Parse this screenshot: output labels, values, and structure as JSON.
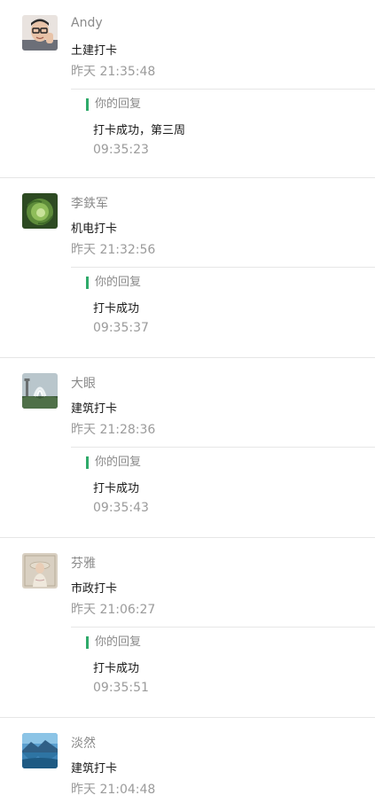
{
  "checkins": [
    {
      "name": "Andy",
      "message": "土建打卡",
      "time": "昨天 21:35:48",
      "avatar": "avatar-man-glasses",
      "reply": {
        "label": "你的回复",
        "text": "打卡成功，第三周",
        "time": "09:35:23"
      }
    },
    {
      "name": "李鉄军",
      "message": "机电打卡",
      "time": "昨天 21:32:56",
      "avatar": "avatar-cabbage",
      "reply": {
        "label": "你的回复",
        "text": "打卡成功",
        "time": "09:35:37"
      }
    },
    {
      "name": "大眼",
      "message": "建筑打卡",
      "time": "昨天 21:28:36",
      "avatar": "avatar-fountain",
      "reply": {
        "label": "你的回复",
        "text": "打卡成功",
        "time": "09:35:43"
      }
    },
    {
      "name": "芬雅",
      "message": "市政打卡",
      "time": "昨天 21:06:27",
      "avatar": "avatar-woman-portrait",
      "reply": {
        "label": "你的回复",
        "text": "打卡成功",
        "time": "09:35:51"
      }
    },
    {
      "name": "淡然",
      "message": "建筑打卡",
      "time": "昨天 21:04:48",
      "avatar": "avatar-lake-landscape"
    }
  ],
  "colors": {
    "accent": "#2faa6a",
    "divider": "#e6e6e6",
    "muted": "#9b9b9b"
  }
}
